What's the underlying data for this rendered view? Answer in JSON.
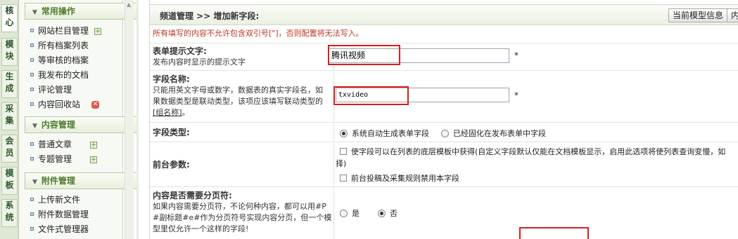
{
  "vtabs": [
    "核心",
    "模块",
    "生成",
    "采集",
    "会员",
    "模板",
    "系统"
  ],
  "sidebar": {
    "sections": [
      {
        "title": "常用操作",
        "items": [
          {
            "label": "网站栏目管理",
            "badge": "plus"
          },
          {
            "label": "所有档案列表"
          },
          {
            "label": "等审核的档案"
          },
          {
            "label": "我发布的文档"
          },
          {
            "label": "评论管理"
          },
          {
            "label": "内容回收站",
            "badge": "delete"
          }
        ]
      },
      {
        "title": "内容管理",
        "items": [
          {
            "label": "普通文章",
            "badge": "plus"
          },
          {
            "label": "专题管理",
            "badge": "plus"
          }
        ]
      },
      {
        "title": "附件管理",
        "items": [
          {
            "label": "上传新文件"
          },
          {
            "label": "附件数据管理"
          },
          {
            "label": "文件式管理器"
          }
        ]
      }
    ]
  },
  "header": {
    "title": "频道管理 >> 增加新字段:",
    "btn_model_info": "当前模型信息",
    "btn_more": "内"
  },
  "warning": "所有填写的内容不允许包含双引号[\"]，否则配置将无法写入。",
  "form": {
    "prompt": {
      "label": "表单提示文字:",
      "desc": "发布内容时显示的提示文字",
      "value": "腾讯视频",
      "required": "*"
    },
    "field_name": {
      "label": "字段名称:",
      "desc_lines": [
        "只能用英文字母或数字，数据表的真实字段名，如",
        "果数据类型是联动类型，该项应该填写联动类型的"
      ],
      "desc_link": "[组名称]",
      "desc_tail": "。",
      "value": "txvideo",
      "required": "*"
    },
    "field_type": {
      "label": "字段类型:",
      "options": [
        {
          "label": "系统自动生成表单字段",
          "checked": true
        },
        {
          "label": "已经固化在发布表单中字段",
          "checked": false
        }
      ]
    },
    "frontend": {
      "label": "前台参数:",
      "opt1_line1": "使字段可以在列表的底层模板中获得(自定义字段默认仅能在文档模板显示，启用此选项将使列表查询变慢，如",
      "opt1_line2": "择)",
      "opt2": "前台投稿及采集规则禁用本字段"
    },
    "paging": {
      "label": "内容是否需要分页符:",
      "desc_lines": [
        "如果内容需要分页符，不论何种内容，都可以用#P",
        "#副标题#e#作为分页符号实现内容分页，但一个模",
        "型里仅允许一个这样的字段!"
      ],
      "options": [
        {
          "label": "是",
          "checked": false
        },
        {
          "label": "否",
          "checked": true
        }
      ]
    }
  },
  "colors": {
    "sidebar_bg": "#f7f9f4",
    "section_text": "#4e7a2c",
    "warning": "#c2341e",
    "highlight": "#d61f1f"
  }
}
